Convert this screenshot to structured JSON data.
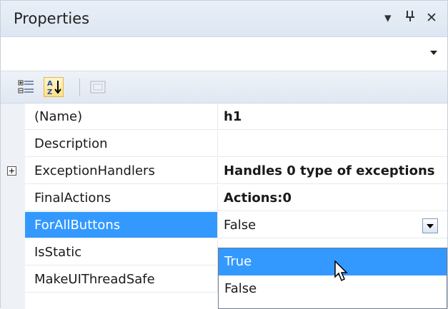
{
  "panel": {
    "title": "Properties",
    "buttons": {
      "dropdown": "▾",
      "pin": "ᛘ",
      "close": "✕"
    }
  },
  "object_selector": {
    "value": ""
  },
  "toolbar": {
    "tools": [
      {
        "name": "categorized-view",
        "icon": "categorized-icon",
        "selected": false
      },
      {
        "name": "alphabetical-view",
        "icon": "sort-az-icon",
        "selected": true
      },
      {
        "name": "property-pages",
        "icon": "property-pages-icon",
        "selected": false,
        "enabled": false
      }
    ]
  },
  "grid": {
    "rows": [
      {
        "name": "(Name)",
        "value": "h1",
        "bold": true,
        "expandable": false
      },
      {
        "name": "Description",
        "value": "",
        "bold": false,
        "expandable": false
      },
      {
        "name": "ExceptionHandlers",
        "value": "Handles 0 type of exceptions",
        "bold": true,
        "expandable": true
      },
      {
        "name": "FinalActions",
        "value": "Actions:0",
        "bold": true,
        "expandable": false
      },
      {
        "name": "ForAllButtons",
        "value": "False",
        "bold": false,
        "expandable": false,
        "selected": true
      },
      {
        "name": "IsStatic",
        "value": "",
        "bold": false,
        "expandable": false
      },
      {
        "name": "MakeUIThreadSafe",
        "value": "",
        "bold": false,
        "expandable": false
      }
    ]
  },
  "dropdown": {
    "options": [
      {
        "label": "True",
        "highlighted": true
      },
      {
        "label": "False",
        "highlighted": false
      }
    ]
  },
  "colors": {
    "selection": "#3399ff",
    "toolbar_selected": "#ffe08a",
    "panel_bg": "#f2f4f8"
  }
}
